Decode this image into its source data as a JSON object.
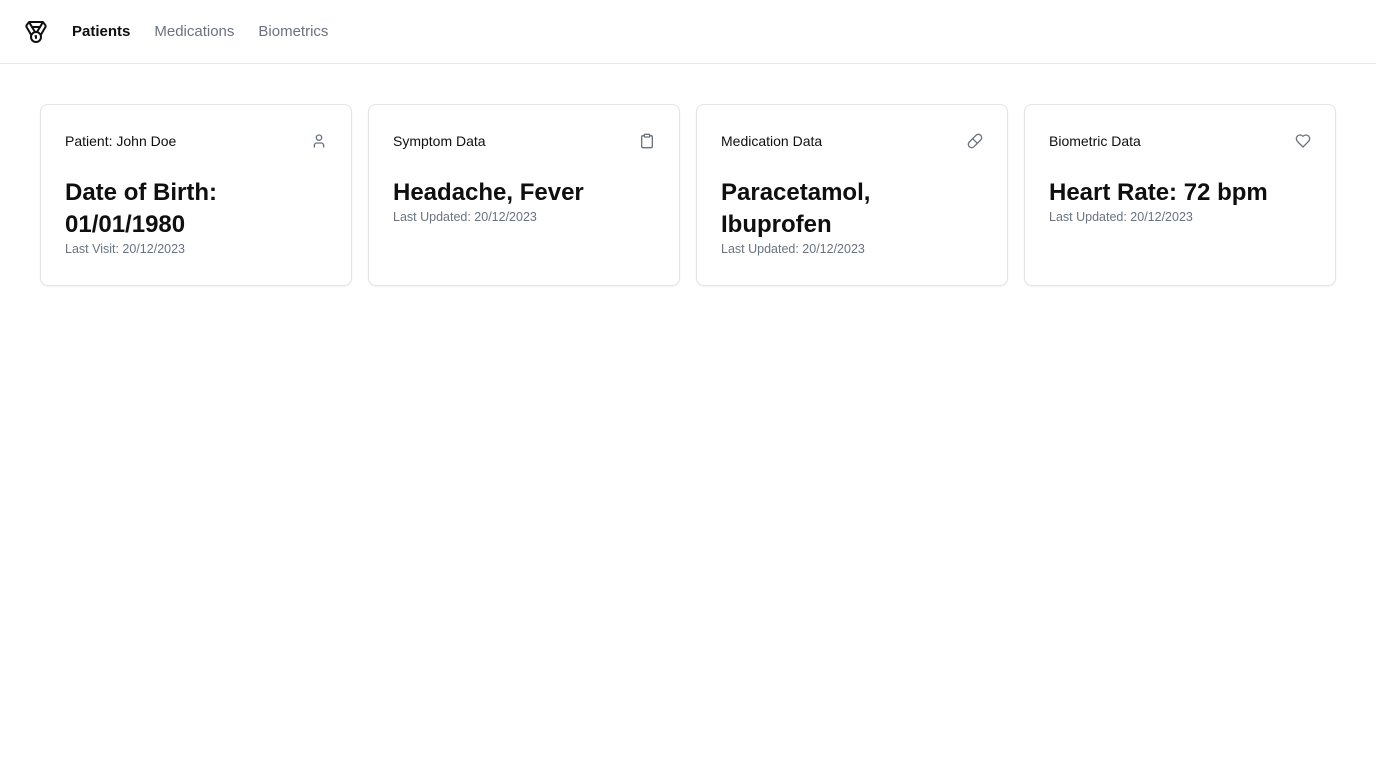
{
  "nav": {
    "items": [
      {
        "label": "Patients",
        "active": true
      },
      {
        "label": "Medications",
        "active": false
      },
      {
        "label": "Biometrics",
        "active": false
      }
    ]
  },
  "cards": [
    {
      "title": "Patient: John Doe",
      "icon": "user-icon",
      "value": "Date of Birth: 01/01/1980",
      "sub": "Last Visit: 20/12/2023"
    },
    {
      "title": "Symptom Data",
      "icon": "clipboard-icon",
      "value": "Headache, Fever",
      "sub": "Last Updated: 20/12/2023"
    },
    {
      "title": "Medication Data",
      "icon": "pill-icon",
      "value": "Paracetamol, Ibuprofen",
      "sub": "Last Updated: 20/12/2023"
    },
    {
      "title": "Biometric Data",
      "icon": "heart-icon",
      "value": "Heart Rate: 72 bpm",
      "sub": "Last Updated: 20/12/2023"
    }
  ],
  "colors": {
    "text": "#0f0f10",
    "muted": "#6b7280",
    "border": "#e4e4e7"
  }
}
